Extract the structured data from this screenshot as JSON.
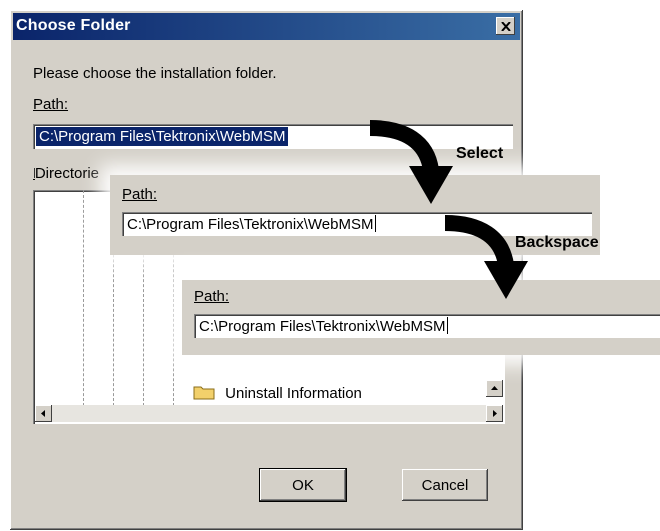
{
  "dialog": {
    "title": "Choose Folder",
    "instruction": "Please choose the installation folder.",
    "path_label": "Path:",
    "path_value": "C:\\Program Files\\Tektronix\\WebMSM",
    "directories_label": "Directorie",
    "visible_folder": "Uninstall Information",
    "ok_label": "OK",
    "cancel_label": "Cancel"
  },
  "steps": [
    {
      "label": "Select"
    },
    {
      "label": "Backspace"
    }
  ],
  "panel1": {
    "path_label": "Path:",
    "path_value": "C:\\Program Files\\Tektronix\\WebMSM"
  },
  "panel2": {
    "path_label": "Path:",
    "path_value": "C:\\Program Files\\Tektronix\\WebMSM"
  },
  "icons": {
    "close": "close-icon",
    "folder": "folder-icon",
    "arrow": "curved-arrow-icon"
  }
}
